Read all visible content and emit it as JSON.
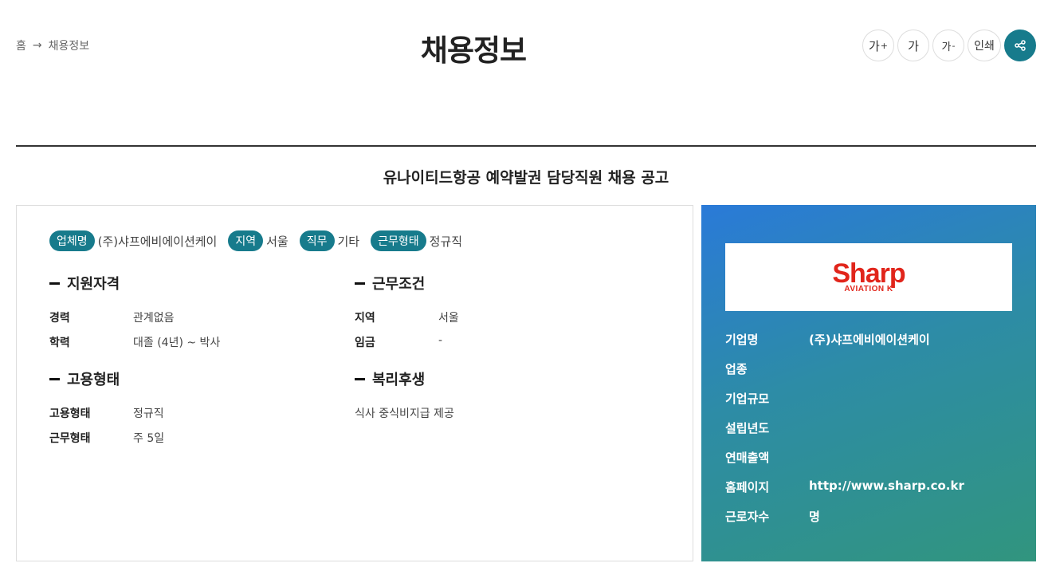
{
  "breadcrumb": {
    "home": "홈",
    "current": "채용정보"
  },
  "page_title": "채용정보",
  "tools": {
    "font_up": "가",
    "font_reset": "가",
    "font_down": "가",
    "print": "인쇄"
  },
  "post_title": "유나이티드항공 예약발권 담당직원 채용 공고",
  "tags": [
    {
      "label": "업체명",
      "value": "(주)샤프에비에이션케이"
    },
    {
      "label": "지역",
      "value": "서울"
    },
    {
      "label": "직무",
      "value": "기타"
    },
    {
      "label": "근무형태",
      "value": "정규직"
    }
  ],
  "qualification": {
    "title": "지원자격",
    "rows": [
      {
        "k": "경력",
        "v": "관계없음"
      },
      {
        "k": "학력",
        "v": "대졸 (4년) ~ 박사"
      }
    ]
  },
  "conditions": {
    "title": "근무조건",
    "rows": [
      {
        "k": "지역",
        "v": "서울"
      },
      {
        "k": "임금",
        "v": "-"
      }
    ]
  },
  "employment": {
    "title": "고용형태",
    "rows": [
      {
        "k": "고용형태",
        "v": "정규직"
      },
      {
        "k": "근무형태",
        "v": "주 5일"
      }
    ]
  },
  "welfare": {
    "title": "복리후생",
    "text": "식사 중식비지급 제공"
  },
  "company": {
    "logo_main": "Sharp",
    "logo_sub": "AVIATION K",
    "rows": [
      {
        "k": "기업명",
        "v": "(주)샤프에비에이션케이"
      },
      {
        "k": "업종",
        "v": ""
      },
      {
        "k": "기업규모",
        "v": ""
      },
      {
        "k": "설립년도",
        "v": ""
      },
      {
        "k": "연매출액",
        "v": ""
      },
      {
        "k": "홈페이지",
        "v": "http://www.sharp.co.kr"
      },
      {
        "k": "근로자수",
        "v": "명"
      }
    ]
  },
  "colors": {
    "accent": "#177b8c",
    "logo_red": "#e1251b"
  }
}
